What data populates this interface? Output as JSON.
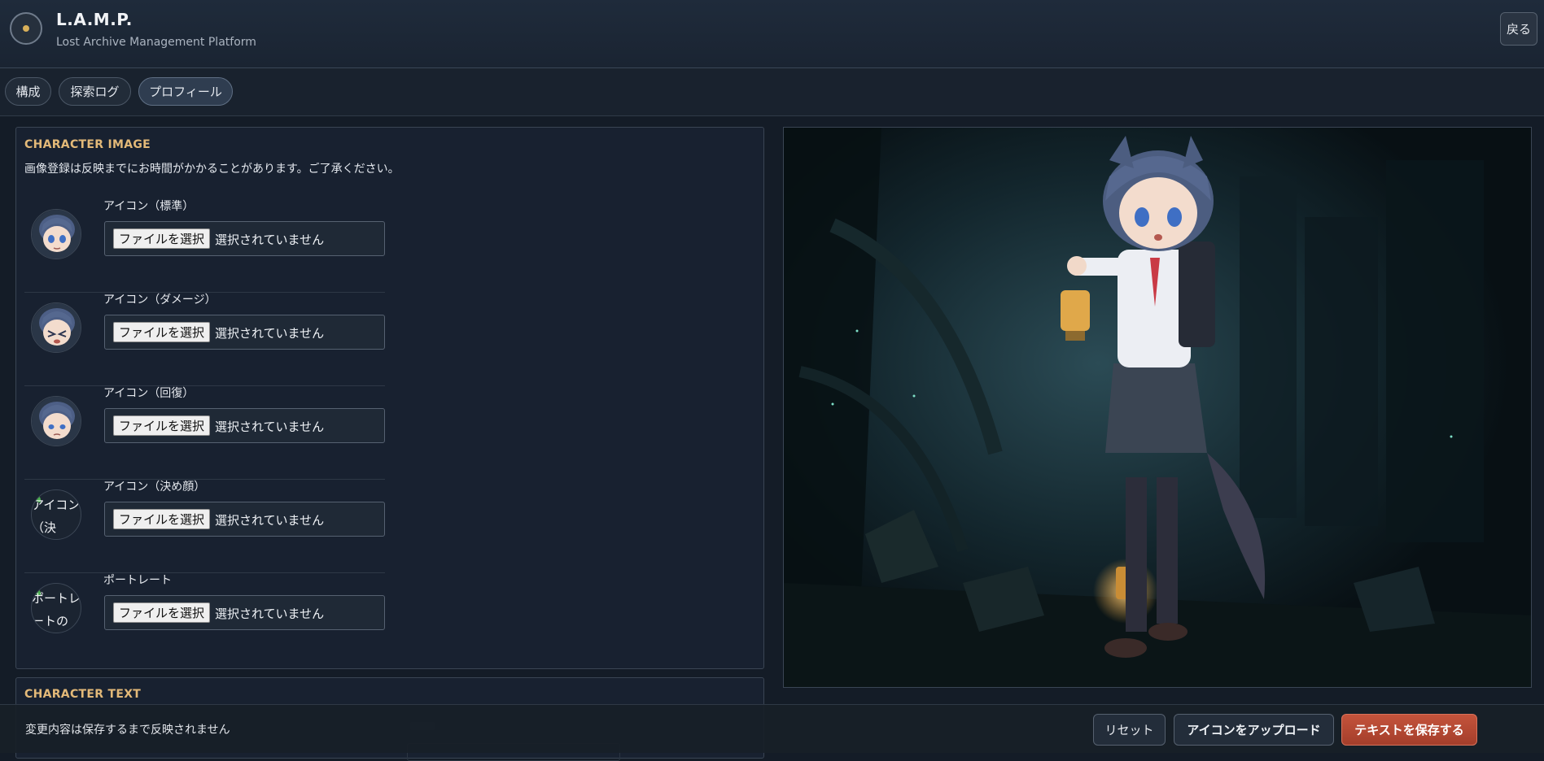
{
  "app": {
    "title": "L.A.M.P.",
    "subtitle": "Lost Archive Management Platform",
    "back_label": "戻る"
  },
  "tabs": [
    {
      "label": "構成"
    },
    {
      "label": "探索ログ"
    },
    {
      "label": "プロフィール",
      "active": true
    }
  ],
  "character_image": {
    "title": "CHARACTER IMAGE",
    "notice": "画像登録は反映までにお時間がかかることがあります。ご了承ください。",
    "file_button_label": "ファイルを選択",
    "file_status": "選択されていません",
    "items": [
      {
        "label": "アイコン（標準）",
        "image": "standard-face"
      },
      {
        "label": "アイコン（ダメージ）",
        "image": "damage-face"
      },
      {
        "label": "アイコン（回復）",
        "image": "recover-face"
      },
      {
        "label": "アイコン（決め顔）",
        "image": "broken",
        "alt_text": "アイコン（決"
      },
      {
        "label": "ポートレート",
        "image": "broken",
        "alt_text": "ポートレートの"
      }
    ]
  },
  "character_text": {
    "title": "CHARACTER TEXT"
  },
  "footer": {
    "unsaved_notice": "変更内容は保存するまで反映されません",
    "reset_label": "リセット",
    "upload_label": "アイコンをアップロード",
    "save_label": "テキストを保存する"
  },
  "colors": {
    "accent_gold": "#e3b978",
    "save_red": "#b8472f",
    "background": "#141c27"
  }
}
